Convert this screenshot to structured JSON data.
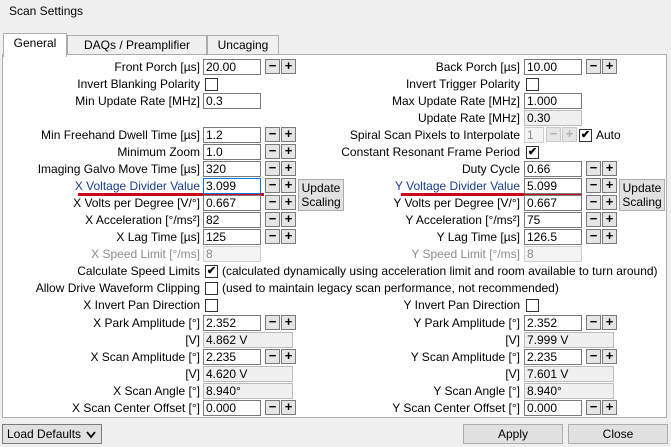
{
  "window_title": "Scan Settings",
  "tabs": [
    "General",
    "DAQs / Preamplifier",
    "Uncaging"
  ],
  "fields": {
    "front_porch": {
      "label": "Front Porch [µs]",
      "value": "20.00"
    },
    "back_porch": {
      "label": "Back Porch [µs]",
      "value": "10.00"
    },
    "invert_blanking": {
      "label": "Invert Blanking Polarity",
      "checked": false
    },
    "invert_trigger": {
      "label": "Invert Trigger Polarity",
      "checked": false
    },
    "min_update_rate": {
      "label": "Min Update Rate [MHz]",
      "value": "0.3"
    },
    "max_update_rate": {
      "label": "Max Update Rate [MHz]",
      "value": "1.000"
    },
    "update_rate": {
      "label": "Update Rate [MHz]",
      "value": "0.30"
    },
    "min_freehand_dwell": {
      "label": "Min Freehand Dwell Time [µs]",
      "value": "1.2"
    },
    "spiral_pixels": {
      "label": "Spiral Scan Pixels to Interpolate",
      "value": "1",
      "auto_label": "Auto",
      "auto_checked": true
    },
    "minimum_zoom": {
      "label": "Minimum Zoom",
      "value": "1.0"
    },
    "constant_resonant": {
      "label": "Constant Resonant Frame Period",
      "checked": true
    },
    "imaging_galvo_move": {
      "label": "Imaging Galvo Move Time [µs]",
      "value": "320"
    },
    "duty_cycle": {
      "label": "Duty Cycle",
      "value": "0.66"
    },
    "x_voltage_divider": {
      "label": "X Voltage Divider Value",
      "value": "3.099"
    },
    "y_voltage_divider": {
      "label": "Y Voltage Divider Value",
      "value": "5.099"
    },
    "x_volts_per_degree": {
      "label": "X Volts per Degree [V/°]",
      "value": "0.667"
    },
    "y_volts_per_degree": {
      "label": "Y Volts per Degree [V/°]",
      "value": "0.667"
    },
    "x_acceleration": {
      "label": "X Acceleration [°/ms²]",
      "value": "82"
    },
    "y_acceleration": {
      "label": "Y Acceleration [°/ms²]",
      "value": "75"
    },
    "x_lag_time": {
      "label": "X Lag Time [µs]",
      "value": "125"
    },
    "y_lag_time": {
      "label": "Y Lag Time [µs]",
      "value": "126.5"
    },
    "x_speed_limit": {
      "label": "X Speed Limit [°/ms]",
      "value": "8"
    },
    "y_speed_limit": {
      "label": "Y Speed Limit [°/ms]",
      "value": "8"
    },
    "calculate_speed_limits": {
      "label": "Calculate Speed Limits",
      "checked": true,
      "note": "(calculated dynamically using acceleration limit and room available to turn around)"
    },
    "allow_drive_clipping": {
      "label": "Allow Drive Waveform Clipping",
      "checked": false,
      "note": "(used to maintain legacy scan performance, not recommended)"
    },
    "x_invert_pan": {
      "label": "X Invert Pan Direction",
      "checked": false
    },
    "y_invert_pan": {
      "label": "Y Invert Pan Direction",
      "checked": false
    },
    "x_park_amplitude": {
      "label": "X Park Amplitude [°]",
      "value": "2.352",
      "volt_label": "[V]",
      "volt_value": "4.862 V"
    },
    "y_park_amplitude": {
      "label": "Y Park Amplitude [°]",
      "value": "2.352",
      "volt_label": "[V]",
      "volt_value": "7.999 V"
    },
    "x_scan_amplitude": {
      "label": "X Scan Amplitude [°]",
      "value": "2.235",
      "volt_label": "[V]",
      "volt_value": "4.620 V"
    },
    "y_scan_amplitude": {
      "label": "Y Scan Amplitude [°]",
      "value": "2.235",
      "volt_label": "[V]",
      "volt_value": "7.601 V"
    },
    "x_scan_angle": {
      "label": "X Scan Angle [°]",
      "value": "8.940°"
    },
    "y_scan_angle": {
      "label": "Y Scan Angle [°]",
      "value": "8.940°"
    },
    "x_scan_center_offset": {
      "label": "X Scan Center Offset [°]",
      "value": "0.000"
    },
    "y_scan_center_offset": {
      "label": "Y Scan Center Offset [°]",
      "value": "0.000"
    }
  },
  "buttons": {
    "update_scaling_line1": "Update",
    "update_scaling_line2": "Scaling",
    "minus": "−",
    "plus": "+",
    "load_defaults": "Load Defaults",
    "apply": "Apply",
    "close": "Close"
  },
  "icons": {
    "check": "✔",
    "dropdown": "chevron-down-icon"
  },
  "colors": {
    "link_label": "#1a3c8c",
    "highlight_underline": "#d0021b",
    "focus_border": "#0078d7"
  }
}
